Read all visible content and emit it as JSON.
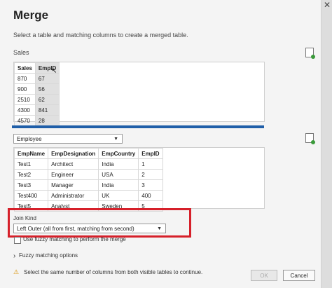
{
  "dialog": {
    "title": "Merge",
    "subtitle": "Select a table and matching columns to create a merged table.",
    "close_glyph": "✕"
  },
  "sales": {
    "label": "Sales",
    "headers": [
      "Sales",
      "EmpID"
    ],
    "rows": [
      [
        "870",
        "67"
      ],
      [
        "900",
        "56"
      ],
      [
        "2510",
        "62"
      ],
      [
        "4300",
        "841"
      ],
      [
        "4570",
        "28"
      ]
    ]
  },
  "employee": {
    "selected": "Employee",
    "headers": [
      "EmpName",
      "EmpDesignation",
      "EmpCountry",
      "EmpID"
    ],
    "rows": [
      [
        "Test1",
        "Architect",
        "India",
        "1"
      ],
      [
        "Test2",
        "Engineer",
        "USA",
        "2"
      ],
      [
        "Test3",
        "Manager",
        "India",
        "3"
      ],
      [
        "Test400",
        "Administrator",
        "UK",
        "400"
      ],
      [
        "Test5",
        "Analyst",
        "Sweden",
        "5"
      ]
    ]
  },
  "join": {
    "label": "Join Kind",
    "selected": "Left Outer (all from first, matching from second)"
  },
  "fuzzy": {
    "checkbox_label": "Use fuzzy matching to perform the merge",
    "options_label": "Fuzzy matching options",
    "expand_glyph": "›"
  },
  "footer": {
    "warning": "Select the same number of columns from both visible tables to continue.",
    "warning_glyph": "⚠",
    "ok_label": "OK",
    "cancel_label": "Cancel"
  },
  "colors": {
    "accent_bar": "#1f5ea8",
    "highlight_box": "#d6202a"
  }
}
